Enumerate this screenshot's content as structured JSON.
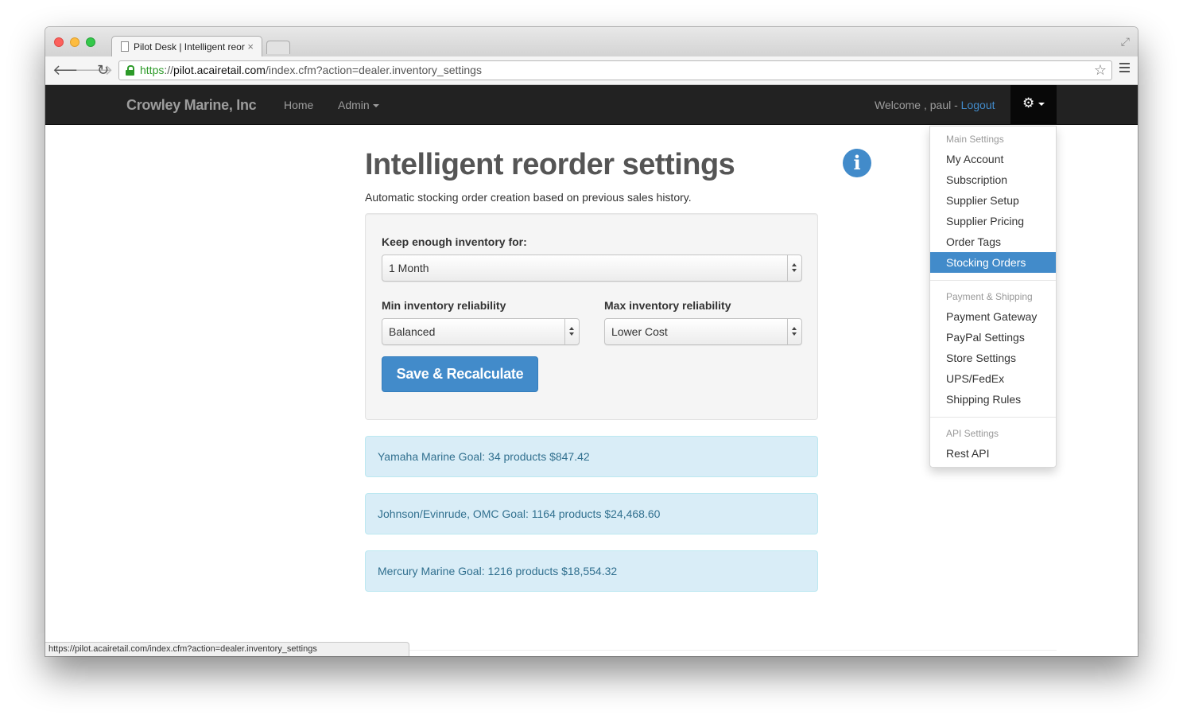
{
  "browser": {
    "tab_title": "Pilot Desk | Intelligent reor",
    "tab_close": "×",
    "url_scheme": "https",
    "url_separator": "://",
    "url_host": "pilot.acairetail.com",
    "url_path": "/index.cfm?action=dealer.inventory_settings",
    "status_url": "https://pilot.acairetail.com/index.cfm?action=dealer.inventory_settings",
    "icons": {
      "back": "arrow-left",
      "forward": "arrow-right",
      "reload": "reload",
      "bookmark": "star",
      "menu": "hamburger",
      "fullscreen": "expand",
      "secure": "lock"
    }
  },
  "navbar": {
    "brand": "Crowley Marine, Inc",
    "home": "Home",
    "admin": "Admin",
    "welcome": "Welcome , paul - ",
    "logout": "Logout",
    "settings_icon": "gear"
  },
  "page": {
    "title": "Intelligent reorder settings",
    "subtitle": "Automatic stocking order creation based on previous sales history.",
    "info_icon_glyph": "i"
  },
  "form": {
    "keep_label": "Keep enough inventory for:",
    "keep_value": "1 Month",
    "min_label": "Min inventory reliability",
    "min_value": "Balanced",
    "max_label": "Max inventory reliability",
    "max_value": "Lower Cost",
    "save_button": "Save & Recalculate"
  },
  "goals": [
    {
      "text": "Yamaha Marine Goal: 34 products $847.42"
    },
    {
      "text": "Johnson/Evinrude, OMC Goal: 1164 products $24,468.60"
    },
    {
      "text": "Mercury Marine Goal: 1216 products $18,554.32"
    }
  ],
  "dropdown": {
    "main_header": "Main Settings",
    "main_items": [
      "My Account",
      "Subscription",
      "Supplier Setup",
      "Supplier Pricing",
      "Order Tags",
      "Stocking Orders"
    ],
    "active_item": "Stocking Orders",
    "payment_header": "Payment & Shipping",
    "payment_items": [
      "Payment Gateway",
      "PayPal Settings",
      "Store Settings",
      "UPS/FedEx",
      "Shipping Rules"
    ],
    "api_header": "API Settings",
    "api_items": [
      "Rest API"
    ]
  },
  "colors": {
    "navbar_bg": "#222222",
    "primary": "#428bca",
    "alert_bg": "#d9edf7",
    "alert_text": "#31708f",
    "secure_green": "#2d9a29"
  }
}
